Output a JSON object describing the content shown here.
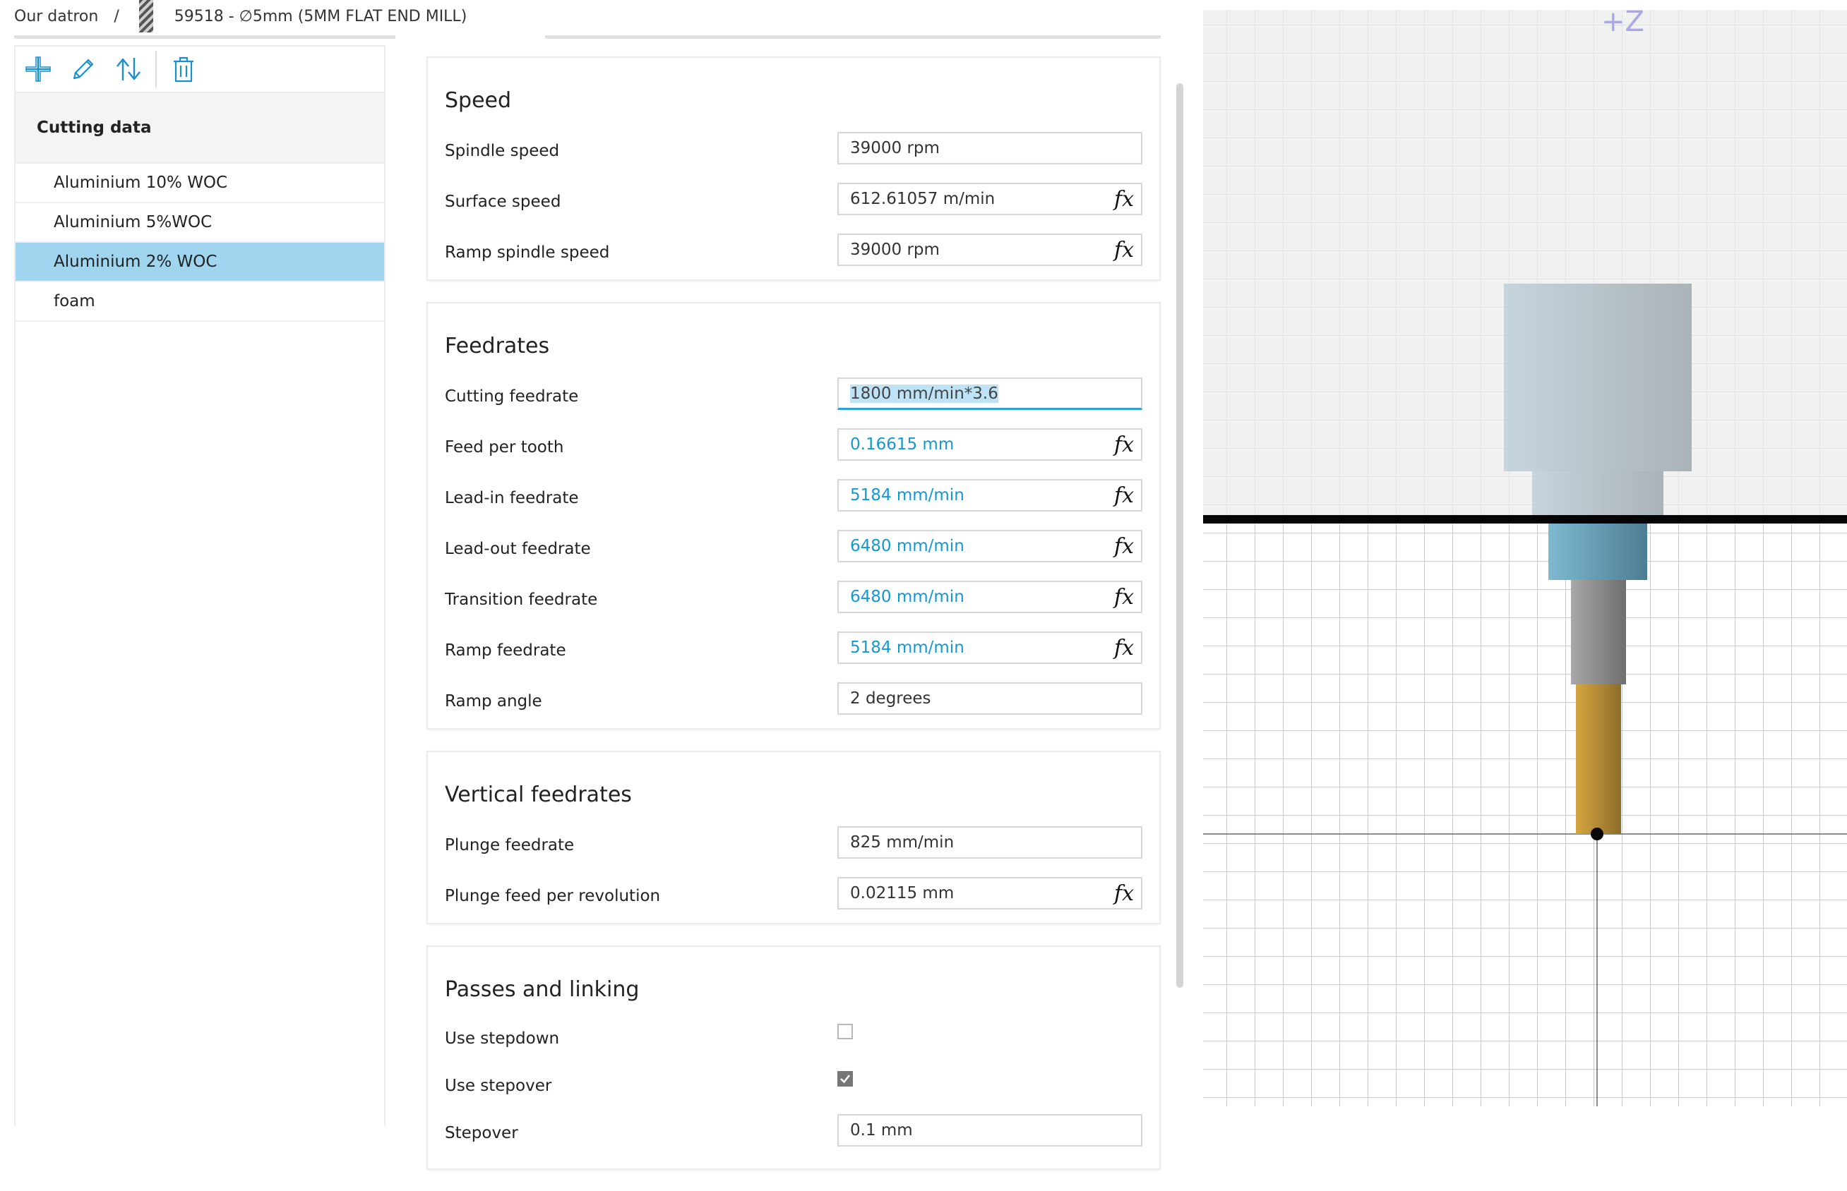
{
  "breadcrumb": {
    "root": "Our datron",
    "separator": "/",
    "tool": "59518 - ∅5mm (5MM FLAT END MILL)"
  },
  "toolbar": {
    "icons": [
      "plus-icon",
      "pencil-icon",
      "sort-icon",
      "trash-icon"
    ]
  },
  "sidebar": {
    "header": "Cutting data",
    "items": [
      {
        "label": "Aluminium 10% WOC",
        "selected": false
      },
      {
        "label": "Aluminium 5%WOC",
        "selected": false
      },
      {
        "label": "Aluminium 2% WOC",
        "selected": true
      },
      {
        "label": "foam",
        "selected": false
      }
    ]
  },
  "speed": {
    "title": "Speed",
    "spindle_speed": {
      "label": "Spindle speed",
      "value": "39000 rpm"
    },
    "surface_speed": {
      "label": "Surface speed",
      "value": "612.61057 m/min"
    },
    "ramp_spindle_speed": {
      "label": "Ramp spindle speed",
      "value": "39000 rpm"
    }
  },
  "feedrates": {
    "title": "Feedrates",
    "cutting_feedrate": {
      "label": "Cutting feedrate",
      "value": "1800 mm/min*3.6"
    },
    "feed_per_tooth": {
      "label": "Feed per tooth",
      "value": "0.16615 mm"
    },
    "lead_in_feedrate": {
      "label": "Lead-in feedrate",
      "value": "5184 mm/min"
    },
    "lead_out_feedrate": {
      "label": "Lead-out feedrate",
      "value": "6480 mm/min"
    },
    "transition_feedrate": {
      "label": "Transition feedrate",
      "value": "6480 mm/min"
    },
    "ramp_feedrate": {
      "label": "Ramp feedrate",
      "value": "5184 mm/min"
    },
    "ramp_angle": {
      "label": "Ramp angle",
      "value": "2 degrees"
    }
  },
  "vertical": {
    "title": "Vertical feedrates",
    "plunge_feedrate": {
      "label": "Plunge feedrate",
      "value": "825 mm/min"
    },
    "plunge_feed_per_revolution": {
      "label": "Plunge feed per revolution",
      "value": "0.02115 mm"
    }
  },
  "passes": {
    "title": "Passes and linking",
    "use_stepdown": {
      "label": "Use stepdown",
      "checked": false
    },
    "use_stepover": {
      "label": "Use stepover",
      "checked": true
    },
    "stepover": {
      "label": "Stepover",
      "value": "0.1 mm"
    }
  },
  "formula_symbol": "fx",
  "viewport": {
    "axis_label": "+Z"
  },
  "colors": {
    "accent": "#1598d0",
    "selected_row": "#9fd5ef",
    "grid_lines": "#9ed0e6",
    "tool_flute": "#c89a3a"
  }
}
